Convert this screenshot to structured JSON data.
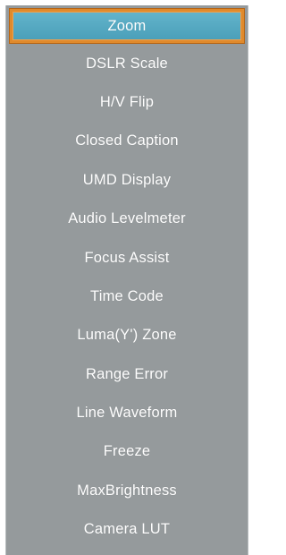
{
  "menu": {
    "items": [
      {
        "label": "Zoom",
        "selected": true
      },
      {
        "label": "DSLR Scale",
        "selected": false
      },
      {
        "label": "H/V Flip",
        "selected": false
      },
      {
        "label": "Closed Caption",
        "selected": false
      },
      {
        "label": "UMD Display",
        "selected": false
      },
      {
        "label": "Audio Levelmeter",
        "selected": false
      },
      {
        "label": "Focus Assist",
        "selected": false
      },
      {
        "label": "Time Code",
        "selected": false
      },
      {
        "label": "Luma(Y') Zone",
        "selected": false
      },
      {
        "label": "Range Error",
        "selected": false
      },
      {
        "label": "Line Waveform",
        "selected": false
      },
      {
        "label": "Freeze",
        "selected": false
      },
      {
        "label": "MaxBrightness",
        "selected": false
      },
      {
        "label": "Camera LUT",
        "selected": false
      }
    ]
  },
  "colors": {
    "panel_bg": "#959a9c",
    "highlight": "#56a9c2",
    "highlight_border": "#e08a2c",
    "text": "#ffffff"
  }
}
